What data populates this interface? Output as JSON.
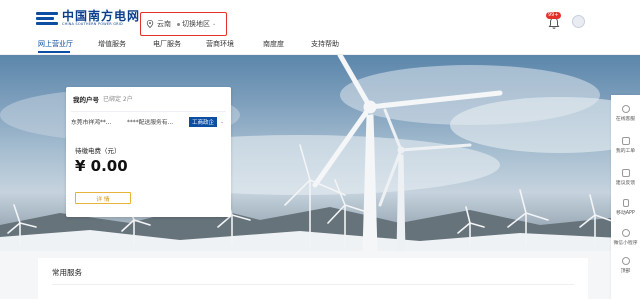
{
  "header": {
    "logo_cn": "中国南方电网",
    "logo_en": "CHINA SOUTHERN POWER GRID",
    "region": "云南",
    "switch_label": "切换地区",
    "notification_count": "99+",
    "icons": [
      "location-pin-icon",
      "bell-icon",
      "user-avatar-icon"
    ]
  },
  "nav": {
    "items": [
      "网上营业厅",
      "增值服务",
      "电厂服务",
      "营商环境",
      "南度度",
      "支持帮助"
    ]
  },
  "account_card": {
    "title": "我的户号",
    "bound_label": "已绑定 2户",
    "account_name": "东莞市祥鸿**...",
    "account_addr": "****配送服务有...",
    "account_type": "工商政企",
    "due_label": "待缴电费（元）",
    "due_amount": "¥ 0.00",
    "detail_button": "详 情"
  },
  "sidebar": {
    "items": [
      "在线客服",
      "我的工单",
      "建议反馈",
      "移动APP",
      "微信小程序",
      "顶部"
    ]
  },
  "services": {
    "title": "常用服务"
  },
  "colors": {
    "brand_blue": "#0b4ea2",
    "highlight_red": "#e5312b",
    "detail_orange": "#e8b33b"
  }
}
